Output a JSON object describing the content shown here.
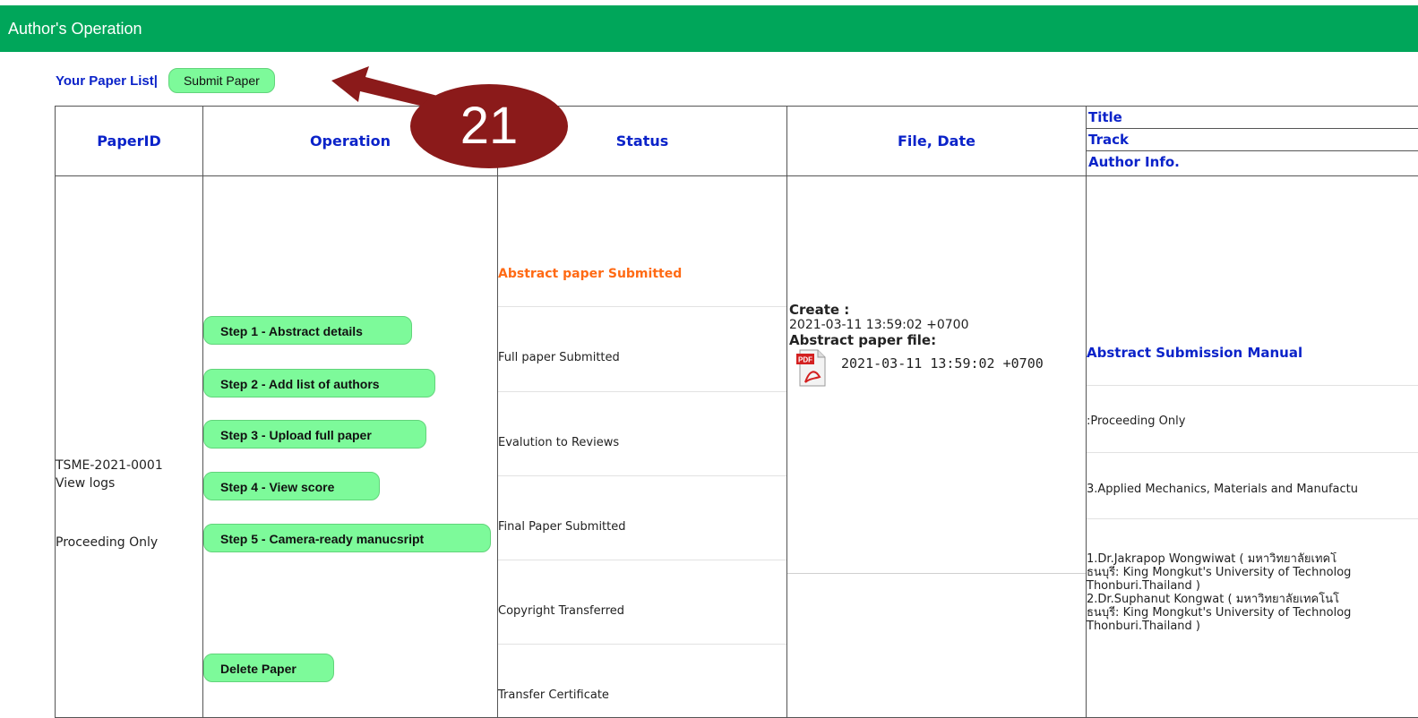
{
  "header": {
    "title": "Author's Operation"
  },
  "paper_list": {
    "title": "Your Paper List|",
    "submit_button": "Submit Paper"
  },
  "table": {
    "headers": {
      "paper_id": "PaperID",
      "operation": "Operation",
      "status": "Status",
      "file_date": "File, Date",
      "meta": [
        "Title",
        "Track",
        "Author Info."
      ]
    },
    "row": {
      "paper_id": "TSME-2021-0001",
      "view_logs": "View logs",
      "type": "Proceeding Only",
      "steps": [
        "Step 1 - Abstract details",
        "Step 2 - Add list of authors",
        "Step 3 - Upload full paper",
        "Step 4 - View score",
        "Step 5 -  Camera-ready manucsript"
      ],
      "delete_button": "Delete Paper",
      "statuses": [
        "Abstract paper Submitted",
        "Full paper Submitted",
        "Evalution to Reviews",
        "Final Paper Submitted",
        "Copyright Transferred",
        "Transfer Certificate"
      ],
      "file": {
        "create_label": "Create :",
        "create_date": "2021-03-11 13:59:02 +0700",
        "abstract_label": "Abstract paper file:",
        "abstract_date": "2021-03-11 13:59:02 +0700",
        "pdf_icon_text": "PDF"
      },
      "info": {
        "manual_title": "Abstract Submission Manual",
        "track_type": ":Proceeding Only",
        "track": "3.Applied Mechanics, Materials and Manufactu",
        "authors_1a": "1.Dr.Jakrapop Wongwiwat ( มหาวิทยาลัยเทคโ",
        "authors_1b": "ธนบุรี: King Mongkut's University of Technolog",
        "authors_1c": "Thonburi.Thailand )",
        "authors_2a": "2.Dr.Suphanut Kongwat ( มหาวิทยาลัยเทคโนโ",
        "authors_2b": "ธนบุรี: King Mongkut's University of Technolog",
        "authors_2c": "Thonburi.Thailand )"
      }
    }
  },
  "annotation": {
    "callout_number": "21"
  },
  "colors": {
    "header_green": "#00a65a",
    "pill_green": "#7dfa9a",
    "link_blue": "#0b23c9",
    "status_orange": "#ff6a14",
    "callout_red": "#8b1a1a"
  }
}
